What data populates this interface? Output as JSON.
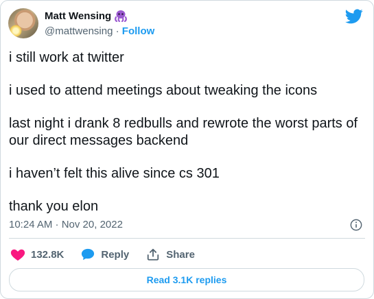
{
  "author": {
    "name": "Matt Wensing",
    "handle": "@mattwensing",
    "separator": "·",
    "follow_label": "Follow"
  },
  "tweet": {
    "paragraphs": [
      "i still work at twitter",
      "i used to attend meetings about tweaking the icons",
      "last night i drank 8 redbulls and rewrote the worst parts of our direct messages backend",
      "i haven’t felt this alive since cs 301",
      "thank you elon"
    ],
    "timestamp": "10:24 AM · Nov 20, 2022"
  },
  "actions": {
    "likes": "132.8K",
    "reply_label": "Reply",
    "share_label": "Share"
  },
  "replies_button": "Read 3.1K replies",
  "colors": {
    "accent": "#1d9bf0",
    "like": "#f91880",
    "muted": "#536471",
    "border": "#cfd9de"
  },
  "icons": [
    "twitter-bird-icon",
    "octopus-emoji-icon",
    "heart-icon",
    "reply-bubble-icon",
    "share-icon",
    "info-icon"
  ]
}
